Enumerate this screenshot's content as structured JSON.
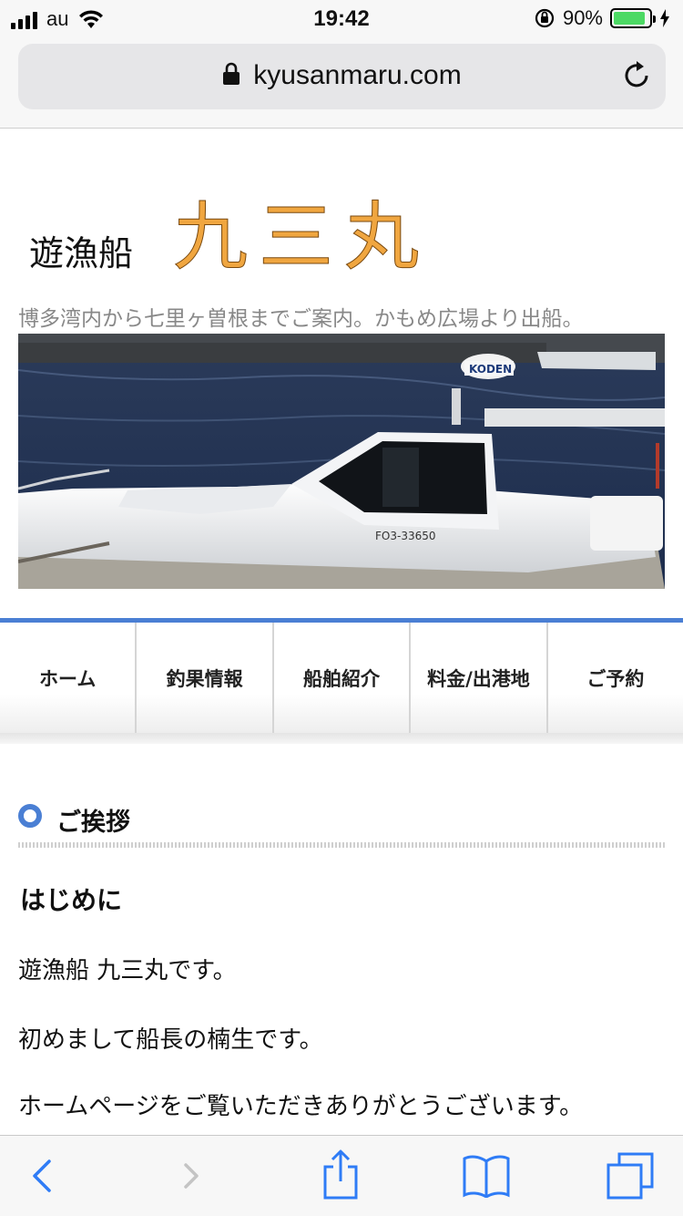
{
  "status_bar": {
    "carrier": "au",
    "time": "19:42",
    "battery_percent": "90%",
    "battery_level": 0.9,
    "icons": [
      "signal-icon",
      "wifi-icon",
      "orientation-lock-icon",
      "battery-icon",
      "charging-icon"
    ]
  },
  "browser": {
    "url": "kyusanmaru.com",
    "icons": [
      "lock-icon",
      "reload-icon"
    ]
  },
  "site": {
    "brand_small": "遊漁船",
    "brand_large": "九三丸",
    "brand_color": "#f0a640",
    "tagline": "博多湾内から七里ヶ曽根までご案内。かもめ広場より出船。",
    "hero_alt": "船体番号 FO3-33650",
    "hero_boat_text": "FO3-33650",
    "hero_radar_text": "KODEN"
  },
  "nav": {
    "accent_color": "#4a7fd4",
    "items": [
      {
        "label": "ホーム"
      },
      {
        "label": "釣果情報"
      },
      {
        "label": "船舶紹介"
      },
      {
        "label": "料金/出港地"
      },
      {
        "label": "ご予約"
      }
    ]
  },
  "content": {
    "section_title": "ご挨拶",
    "subhead": "はじめに",
    "paragraphs": [
      "遊漁船 九三丸です。",
      "初めまして船長の楠生です。",
      "ホームページをご覧いただきありがとうございます。"
    ]
  },
  "toolbar": {
    "icons": [
      "back-icon",
      "forward-icon",
      "share-icon",
      "bookmarks-icon",
      "tabs-icon"
    ],
    "tint_color": "#2f7cf6"
  }
}
